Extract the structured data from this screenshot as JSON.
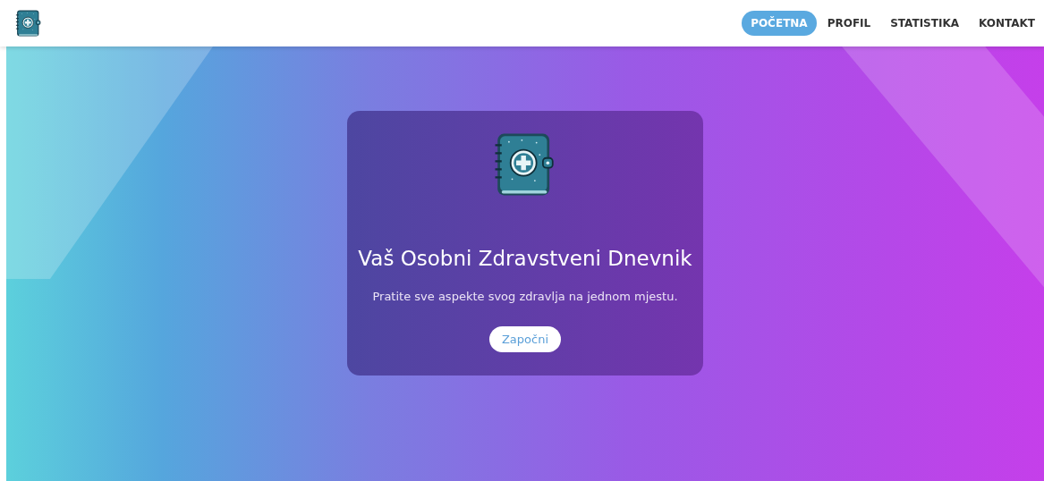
{
  "nav": {
    "items": [
      {
        "label": "POČETNA",
        "selected": true
      },
      {
        "label": "PROFIL",
        "selected": false
      },
      {
        "label": "STATISTIKA",
        "selected": false
      },
      {
        "label": "KONTAKT",
        "selected": false
      }
    ]
  },
  "hero": {
    "title": "Vaš Osobni Zdravstveni Dnevnik",
    "subtitle": "Pratite sve aspekte svog zdravlja na jednom mjestu.",
    "button": "Započni"
  }
}
